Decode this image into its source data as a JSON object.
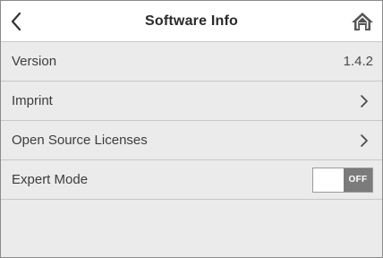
{
  "header": {
    "title": "Software Info"
  },
  "rows": [
    {
      "label": "Version",
      "value": "1.4.2"
    },
    {
      "label": "Imprint"
    },
    {
      "label": "Open Source Licenses"
    },
    {
      "label": "Expert Mode",
      "toggle_state": "OFF"
    }
  ],
  "icons": {
    "back": "chevron-left-icon",
    "home": "home-icon",
    "row_arrow": "chevron-right-icon"
  },
  "colors": {
    "header_bg": "#ffffff",
    "list_bg": "#ebebeb",
    "divider": "#c8c8c8",
    "toggle_off": "#7b7b7b"
  }
}
